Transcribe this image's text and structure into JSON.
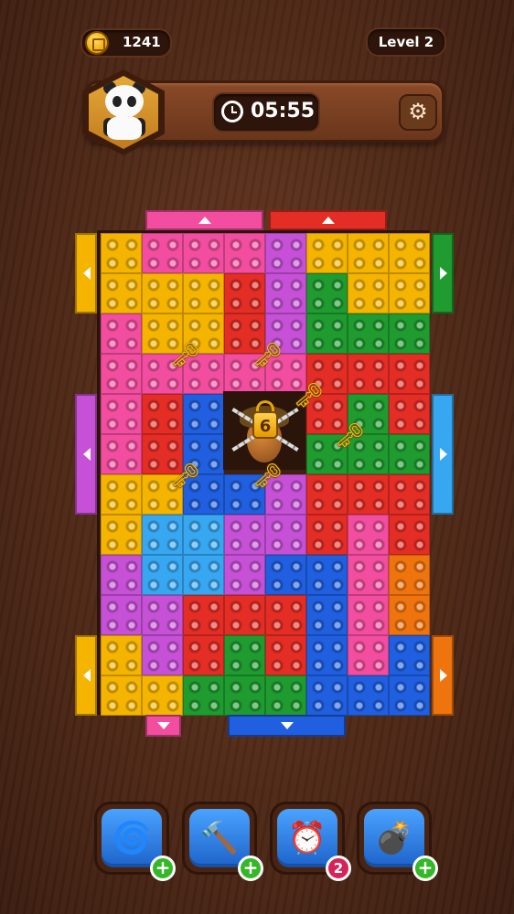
{
  "colors": {
    "yellow": "#f4b400",
    "pink": "#f24d9f",
    "purple": "#c651d6",
    "red": "#e42d25",
    "green": "#1f9b2f",
    "blue": "#1f5fe0",
    "lightblue": "#37a7f2",
    "orange": "#f0740e"
  },
  "header": {
    "coins": "1241",
    "level": "Level 2",
    "timer": "05:55",
    "avatar": "panda-icon",
    "settings_icon": "gear-icon"
  },
  "board": {
    "columns": 8,
    "rows": 12,
    "grid": [
      [
        "yellow",
        "pink",
        "pink",
        "pink",
        "purple",
        "yellow",
        "yellow",
        "yellow"
      ],
      [
        "yellow",
        "yellow",
        "yellow",
        "red",
        "purple",
        "green",
        "yellow",
        "yellow"
      ],
      [
        "pink",
        "yellow",
        "yellow",
        "red",
        "purple",
        "green",
        "green",
        "green"
      ],
      [
        "pink",
        "pink",
        "pink",
        "pink",
        "pink",
        "red",
        "red",
        "red"
      ],
      [
        "pink",
        "red",
        "blue",
        "empty",
        "empty",
        "red",
        "green",
        "red"
      ],
      [
        "pink",
        "red",
        "blue",
        "empty",
        "empty",
        "green",
        "green",
        "green"
      ],
      [
        "yellow",
        "yellow",
        "blue",
        "blue",
        "purple",
        "red",
        "red",
        "red"
      ],
      [
        "yellow",
        "lightblue",
        "lightblue",
        "purple",
        "purple",
        "red",
        "pink",
        "red"
      ],
      [
        "purple",
        "lightblue",
        "lightblue",
        "purple",
        "blue",
        "blue",
        "pink",
        "orange"
      ],
      [
        "purple",
        "purple",
        "red",
        "red",
        "red",
        "blue",
        "pink",
        "orange"
      ],
      [
        "yellow",
        "purple",
        "red",
        "green",
        "red",
        "blue",
        "pink",
        "blue"
      ],
      [
        "yellow",
        "yellow",
        "green",
        "green",
        "green",
        "blue",
        "blue",
        "blue"
      ]
    ],
    "keys": [
      [
        3,
        2
      ],
      [
        3,
        4
      ],
      [
        4,
        5
      ],
      [
        5,
        6
      ],
      [
        6,
        2
      ],
      [
        6,
        4
      ]
    ],
    "locked_count": "6"
  },
  "gates": [
    {
      "side": "top",
      "start": 1,
      "span": 3,
      "color": "pink",
      "arrow": "up"
    },
    {
      "side": "top",
      "start": 4,
      "span": 3,
      "color": "red",
      "arrow": "up"
    },
    {
      "side": "left",
      "start": 0,
      "span": 2,
      "color": "yellow",
      "arrow": "left"
    },
    {
      "side": "left",
      "start": 4,
      "span": 3,
      "color": "purple",
      "arrow": "left"
    },
    {
      "side": "left",
      "start": 10,
      "span": 2,
      "color": "yellow",
      "arrow": "left"
    },
    {
      "side": "right",
      "start": 0,
      "span": 2,
      "color": "green",
      "arrow": "right"
    },
    {
      "side": "right",
      "start": 4,
      "span": 3,
      "color": "lightblue",
      "arrow": "right"
    },
    {
      "side": "right",
      "start": 10,
      "span": 2,
      "color": "orange",
      "arrow": "right"
    },
    {
      "side": "bottom",
      "start": 1,
      "span": 1,
      "color": "pink",
      "arrow": "down"
    },
    {
      "side": "bottom",
      "start": 3,
      "span": 3,
      "color": "blue",
      "arrow": "down"
    }
  ],
  "boosters": [
    {
      "icon": "drill-icon",
      "badge": "+",
      "badge_type": "plus"
    },
    {
      "icon": "hammer-icon",
      "badge": "+",
      "badge_type": "plus"
    },
    {
      "icon": "alarm-clock-icon",
      "badge": "2",
      "badge_type": "count"
    },
    {
      "icon": "cannon-icon",
      "badge": "+",
      "badge_type": "plus"
    }
  ]
}
